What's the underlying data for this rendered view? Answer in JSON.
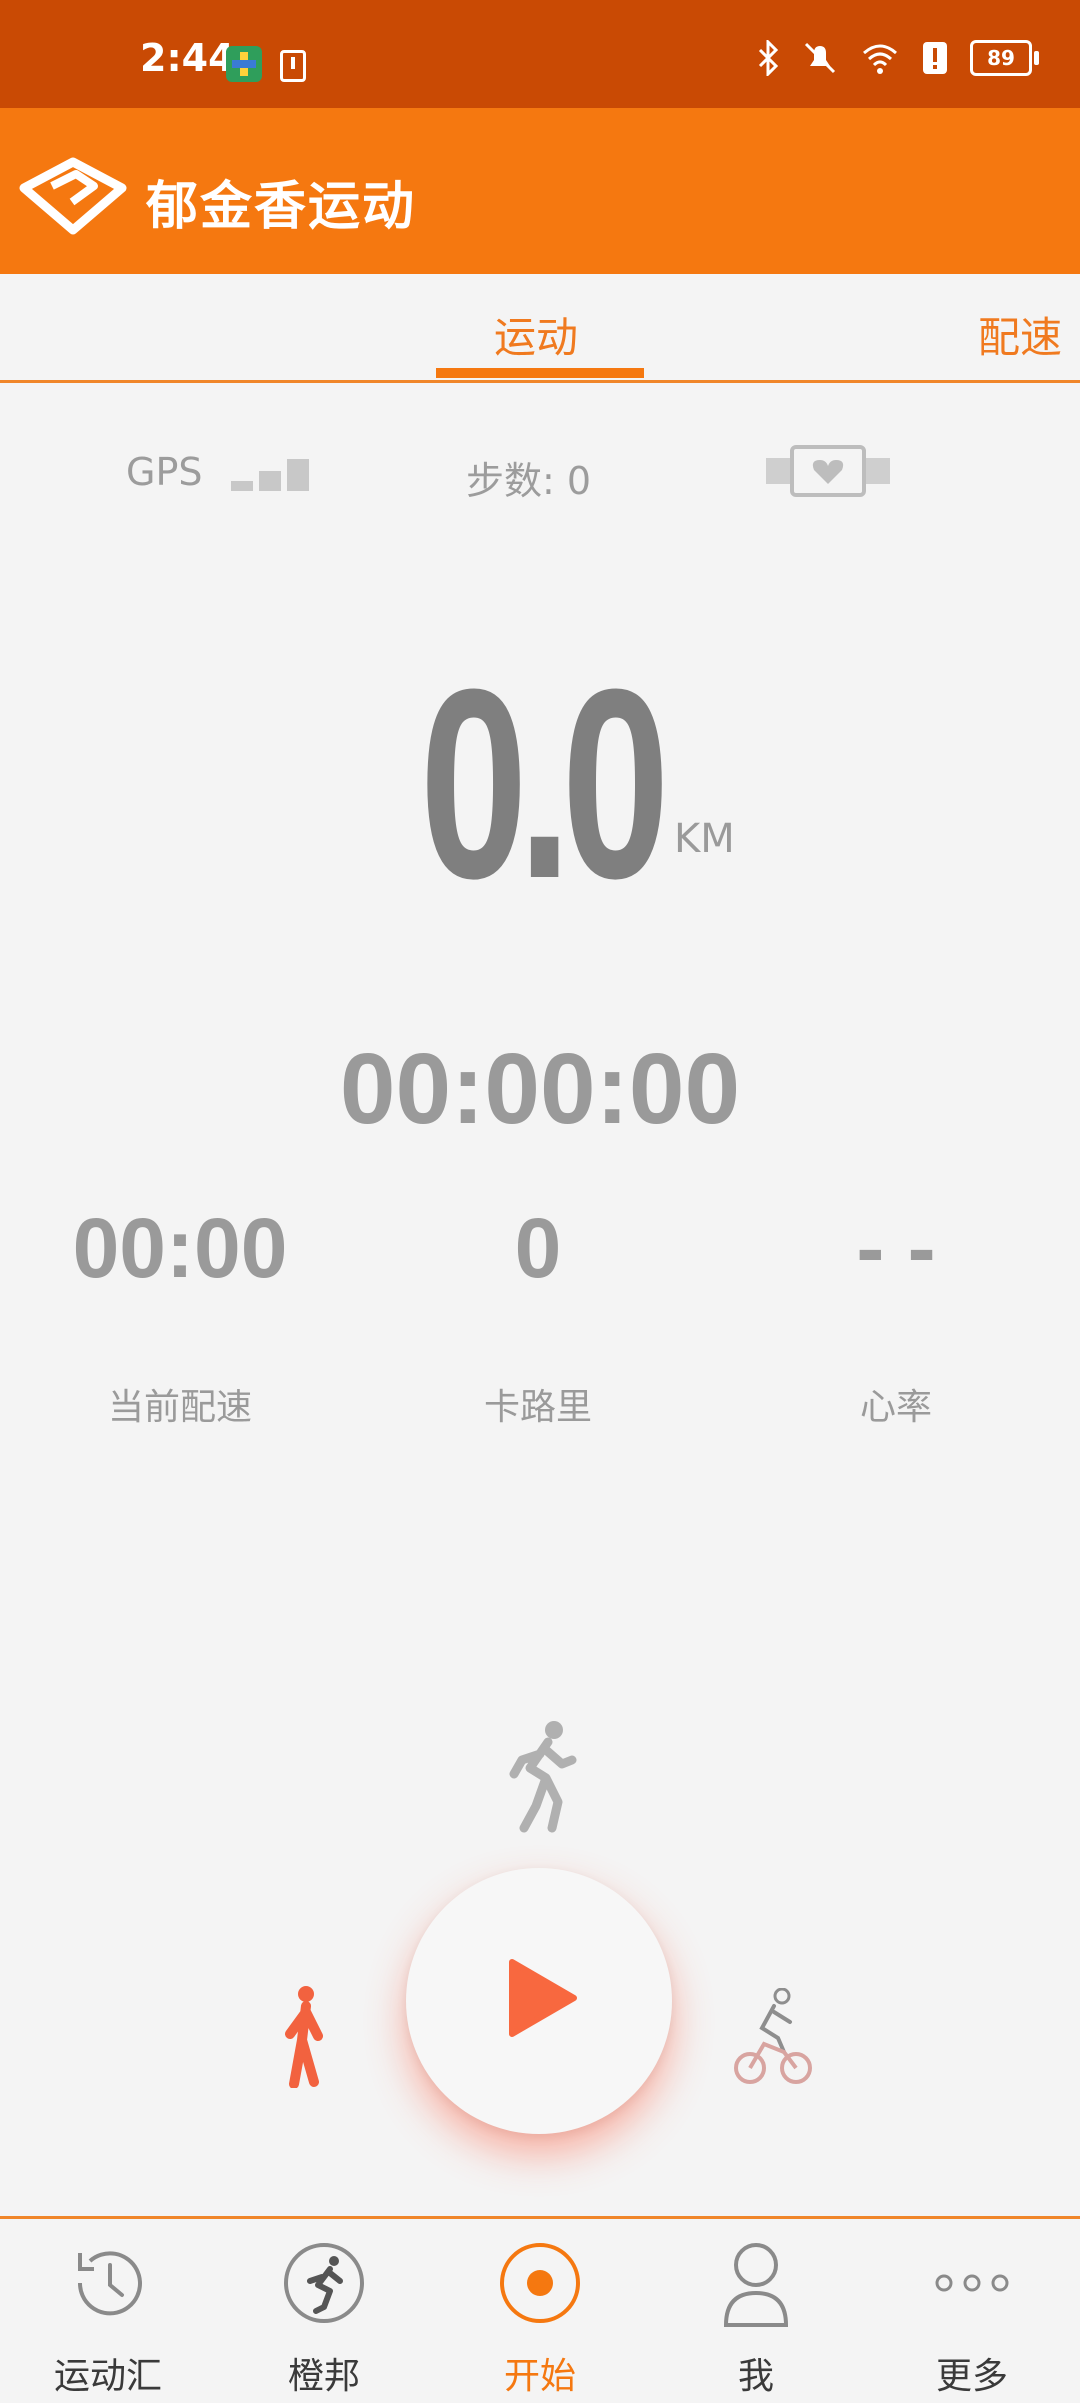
{
  "status_bar": {
    "time": "2:44",
    "battery": "89"
  },
  "app": {
    "title": "郁金香运动",
    "accent_color": "#f57810"
  },
  "tabs": [
    {
      "label": "运动",
      "active": true
    },
    {
      "label": "配速",
      "active": false
    }
  ],
  "indicators": {
    "gps_label": "GPS",
    "steps_label": "步数:",
    "steps_value": "0"
  },
  "main": {
    "distance": "0.0",
    "distance_unit": "KM",
    "duration": "00:00:00"
  },
  "stats": [
    {
      "value": "00:00",
      "label": "当前配速"
    },
    {
      "value": "0",
      "label": "卡路里"
    },
    {
      "value": "- -",
      "label": "心率"
    }
  ],
  "modes": [
    "walk-icon",
    "run-icon",
    "bike-icon"
  ],
  "nav": [
    {
      "label": "运动汇",
      "icon": "history-clock-icon",
      "active": false
    },
    {
      "label": "橙邦",
      "icon": "runner-circle-icon",
      "active": false
    },
    {
      "label": "开始",
      "icon": "record-icon",
      "active": true
    },
    {
      "label": "我",
      "icon": "person-icon",
      "active": false
    },
    {
      "label": "更多",
      "icon": "more-dots-icon",
      "active": false
    }
  ]
}
